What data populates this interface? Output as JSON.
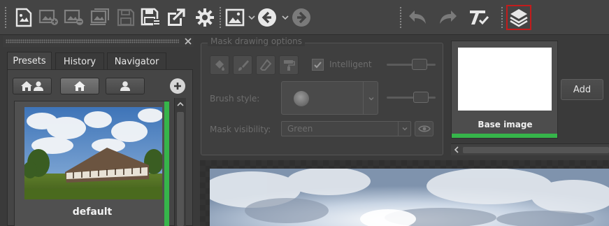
{
  "toolbar": {
    "buttons": [
      {
        "icon": "open-image-icon",
        "enabled": true
      },
      {
        "icon": "add-image-icon",
        "enabled": false
      },
      {
        "icon": "remove-image-icon",
        "enabled": false
      },
      {
        "icon": "batch-images-icon",
        "enabled": false
      },
      {
        "icon": "save-disabled-icon",
        "enabled": false
      },
      {
        "icon": "save-as-icon",
        "enabled": true
      },
      {
        "icon": "export-icon",
        "enabled": true
      },
      {
        "icon": "settings-gear-icon",
        "enabled": true
      },
      {
        "icon": "image-view-icon",
        "enabled": true
      },
      {
        "icon": "back-arrow-icon",
        "enabled": true
      },
      {
        "icon": "forward-arrow-icon",
        "enabled": false
      },
      {
        "icon": "undo-icon",
        "enabled": false
      },
      {
        "icon": "redo-icon",
        "enabled": false
      },
      {
        "icon": "clear-adjustments-icon",
        "enabled": true
      },
      {
        "icon": "layers-icon",
        "enabled": true,
        "highlighted": true
      }
    ],
    "highlight_color": "#c21c1c"
  },
  "left_panel": {
    "tabs": [
      "Presets",
      "History",
      "Navigator"
    ],
    "active_tab": "Presets",
    "filter_buttons": [
      "all-presets-icon",
      "builtin-presets-icon",
      "user-presets-icon"
    ],
    "add_button_icon": "plus-circle-icon",
    "preset": {
      "name": "default"
    },
    "accent_color": "#36b54a"
  },
  "mask": {
    "title": "Mask drawing options",
    "tools": [
      "fill-bucket-icon",
      "brush-icon",
      "eraser-icon",
      "paint-roller-icon"
    ],
    "intelligent": {
      "label": "Intelligent",
      "checked": true
    },
    "brush_style_label": "Brush style:",
    "visibility_label": "Mask visibility:",
    "visibility_value": "Green"
  },
  "layers": {
    "base_label": "Base image",
    "add_label": "Add"
  }
}
